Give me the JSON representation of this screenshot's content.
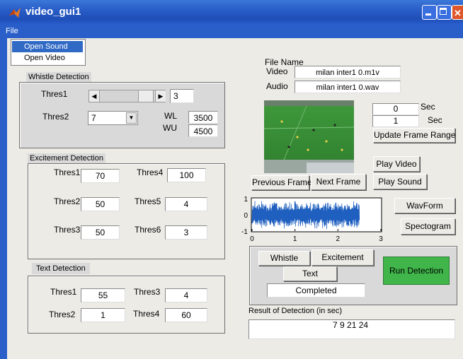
{
  "window": {
    "title": "video_gui1"
  },
  "menu": {
    "file": "File",
    "items": [
      "Open Sound",
      "Open Video"
    ]
  },
  "whistle": {
    "title": "Whistle Detection",
    "thres1_label": "Thres1",
    "thres1_value": "3",
    "thres2_label": "Thres2",
    "thres2_selected": "7",
    "wl_label": "WL",
    "wl_value": "3500",
    "wu_label": "WU",
    "wu_value": "4500"
  },
  "excitement": {
    "title": "Excitement Detection",
    "thres1_label": "Thres1",
    "thres1_value": "70",
    "thres2_label": "Thres2",
    "thres2_value": "50",
    "thres3_label": "Thres3",
    "thres3_value": "50",
    "thres4_label": "Thres4",
    "thres4_value": "100",
    "thres5_label": "Thres5",
    "thres5_value": "4",
    "thres6_label": "Thres6",
    "thres6_value": "3"
  },
  "text_detection": {
    "title": "Text Detection",
    "thres1_label": "Thres1",
    "thres1_value": "55",
    "thres2_label": "Thres2",
    "thres2_value": "1",
    "thres3_label": "Thres3",
    "thres3_value": "4",
    "thres4_label": "Thres4",
    "thres4_value": "60"
  },
  "file_info": {
    "heading": "File Name",
    "video_label": "Video",
    "video_value": "milan  inter1  0.m1v",
    "audio_label": "Audio",
    "audio_value": "milan inter1  0.wav"
  },
  "frame_range": {
    "start": "0",
    "end": "1",
    "sec1": "Sec",
    "sec2": "Sec",
    "update_button": "Update Frame Range"
  },
  "buttons": {
    "previous_frame": "Previous Frame",
    "next_frame": "Next Frame",
    "play_video": "Play Video",
    "play_sound": "Play Sound",
    "wavform": "WavForm",
    "spectogram": "Spectogram",
    "whistle": "Whistle",
    "excitement": "Excitement",
    "text": "Text",
    "run_detection": "Run Detection"
  },
  "status": {
    "text": "Completed"
  },
  "result": {
    "label": "Result of Detection (in sec)",
    "value": "7  9 21 24"
  },
  "chart_data": {
    "type": "line",
    "y_ticks": [
      "1",
      "0",
      "-1"
    ],
    "x_ticks": [
      "0",
      "1",
      "2",
      "3"
    ],
    "xlim": [
      0,
      3
    ],
    "ylim": [
      -1,
      1
    ],
    "signal_extent": [
      0,
      2.5
    ],
    "series_color": "#1f5fbf"
  },
  "colors": {
    "run_button": "#3fb54a",
    "titlebar": "#2a5fc9",
    "wave": "#1f5fbf"
  }
}
